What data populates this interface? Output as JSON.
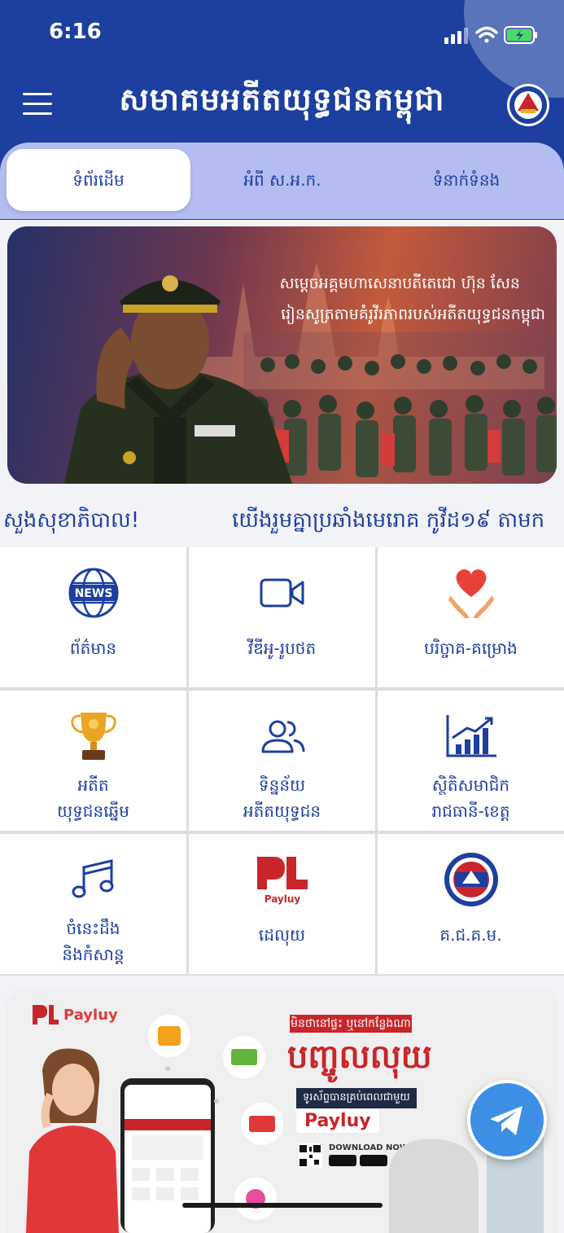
{
  "status_bar": {
    "time": "6:16"
  },
  "header": {
    "title": "សមាគមអតីតយុទ្ធជនកម្ពុជា"
  },
  "tabs": [
    {
      "label": "ទំព័រដើម"
    },
    {
      "label": "អំពី ស.អ.ក."
    },
    {
      "label": "ទំនាក់ទំនង"
    }
  ],
  "hero": {
    "line1": "សម្តេចអគ្គមហាសេនាបតីតេជោ ហ៊ុន សែន",
    "line2": "រៀនសូត្រតាមគំរូវីរភាពរបស់អតីតយុទ្ធជនកម្ពុជា"
  },
  "marquee": {
    "part1": "សួងសុខាភិបាល!",
    "part2": "យើងរួមគ្នាប្រឆាំងមេរោគ កូវីដ១៩ តាមក"
  },
  "grid": {
    "news": {
      "icon": "news-icon",
      "label": "ព័ត៌មាន"
    },
    "video": {
      "icon": "video-camera-icon",
      "label": "វីឌីអូ-រូបថត"
    },
    "donate": {
      "icon": "heart-hands-icon",
      "label": "បរិច្ចាគ-គម្រោង"
    },
    "veteran": {
      "icon": "trophy-icon",
      "line1": "អតីត",
      "line2": "យុទ្ធជនឆ្នើម"
    },
    "data": {
      "icon": "users-icon",
      "line1": "ទិន្នន័យ",
      "line2": "អតីតយុទ្ធជន"
    },
    "stats": {
      "icon": "bar-chart-icon",
      "line1": "ស្ថិតិសមាជិក",
      "line2": "រាជធានី-ខេត្ត"
    },
    "songs": {
      "icon": "music-note-icon",
      "line1": "ចំនេះដឹង",
      "line2": "និងកំសាន្ត"
    },
    "payluy": {
      "icon": "payluy-logo-icon",
      "label": "ដេលុយ"
    },
    "kkm": {
      "icon": "kkm-emblem-icon",
      "label": "គ.ជ.គ.ម."
    }
  },
  "ad": {
    "brand": "Payluy",
    "headline_top": "មិនថានៅផ្ទះ ឬនៅកន្លែងណា",
    "headline": "បញ្ចូលលុយ",
    "sub": "ទូរស័ព្ទបានគ្រប់ពេលជាមួយ",
    "pay": "Payluy",
    "download": "DOWNLOAD NOW"
  },
  "colors": {
    "primary": "#1d3f9f",
    "tab_bar": "#b4bdf0",
    "accent_red": "#c8262a"
  }
}
